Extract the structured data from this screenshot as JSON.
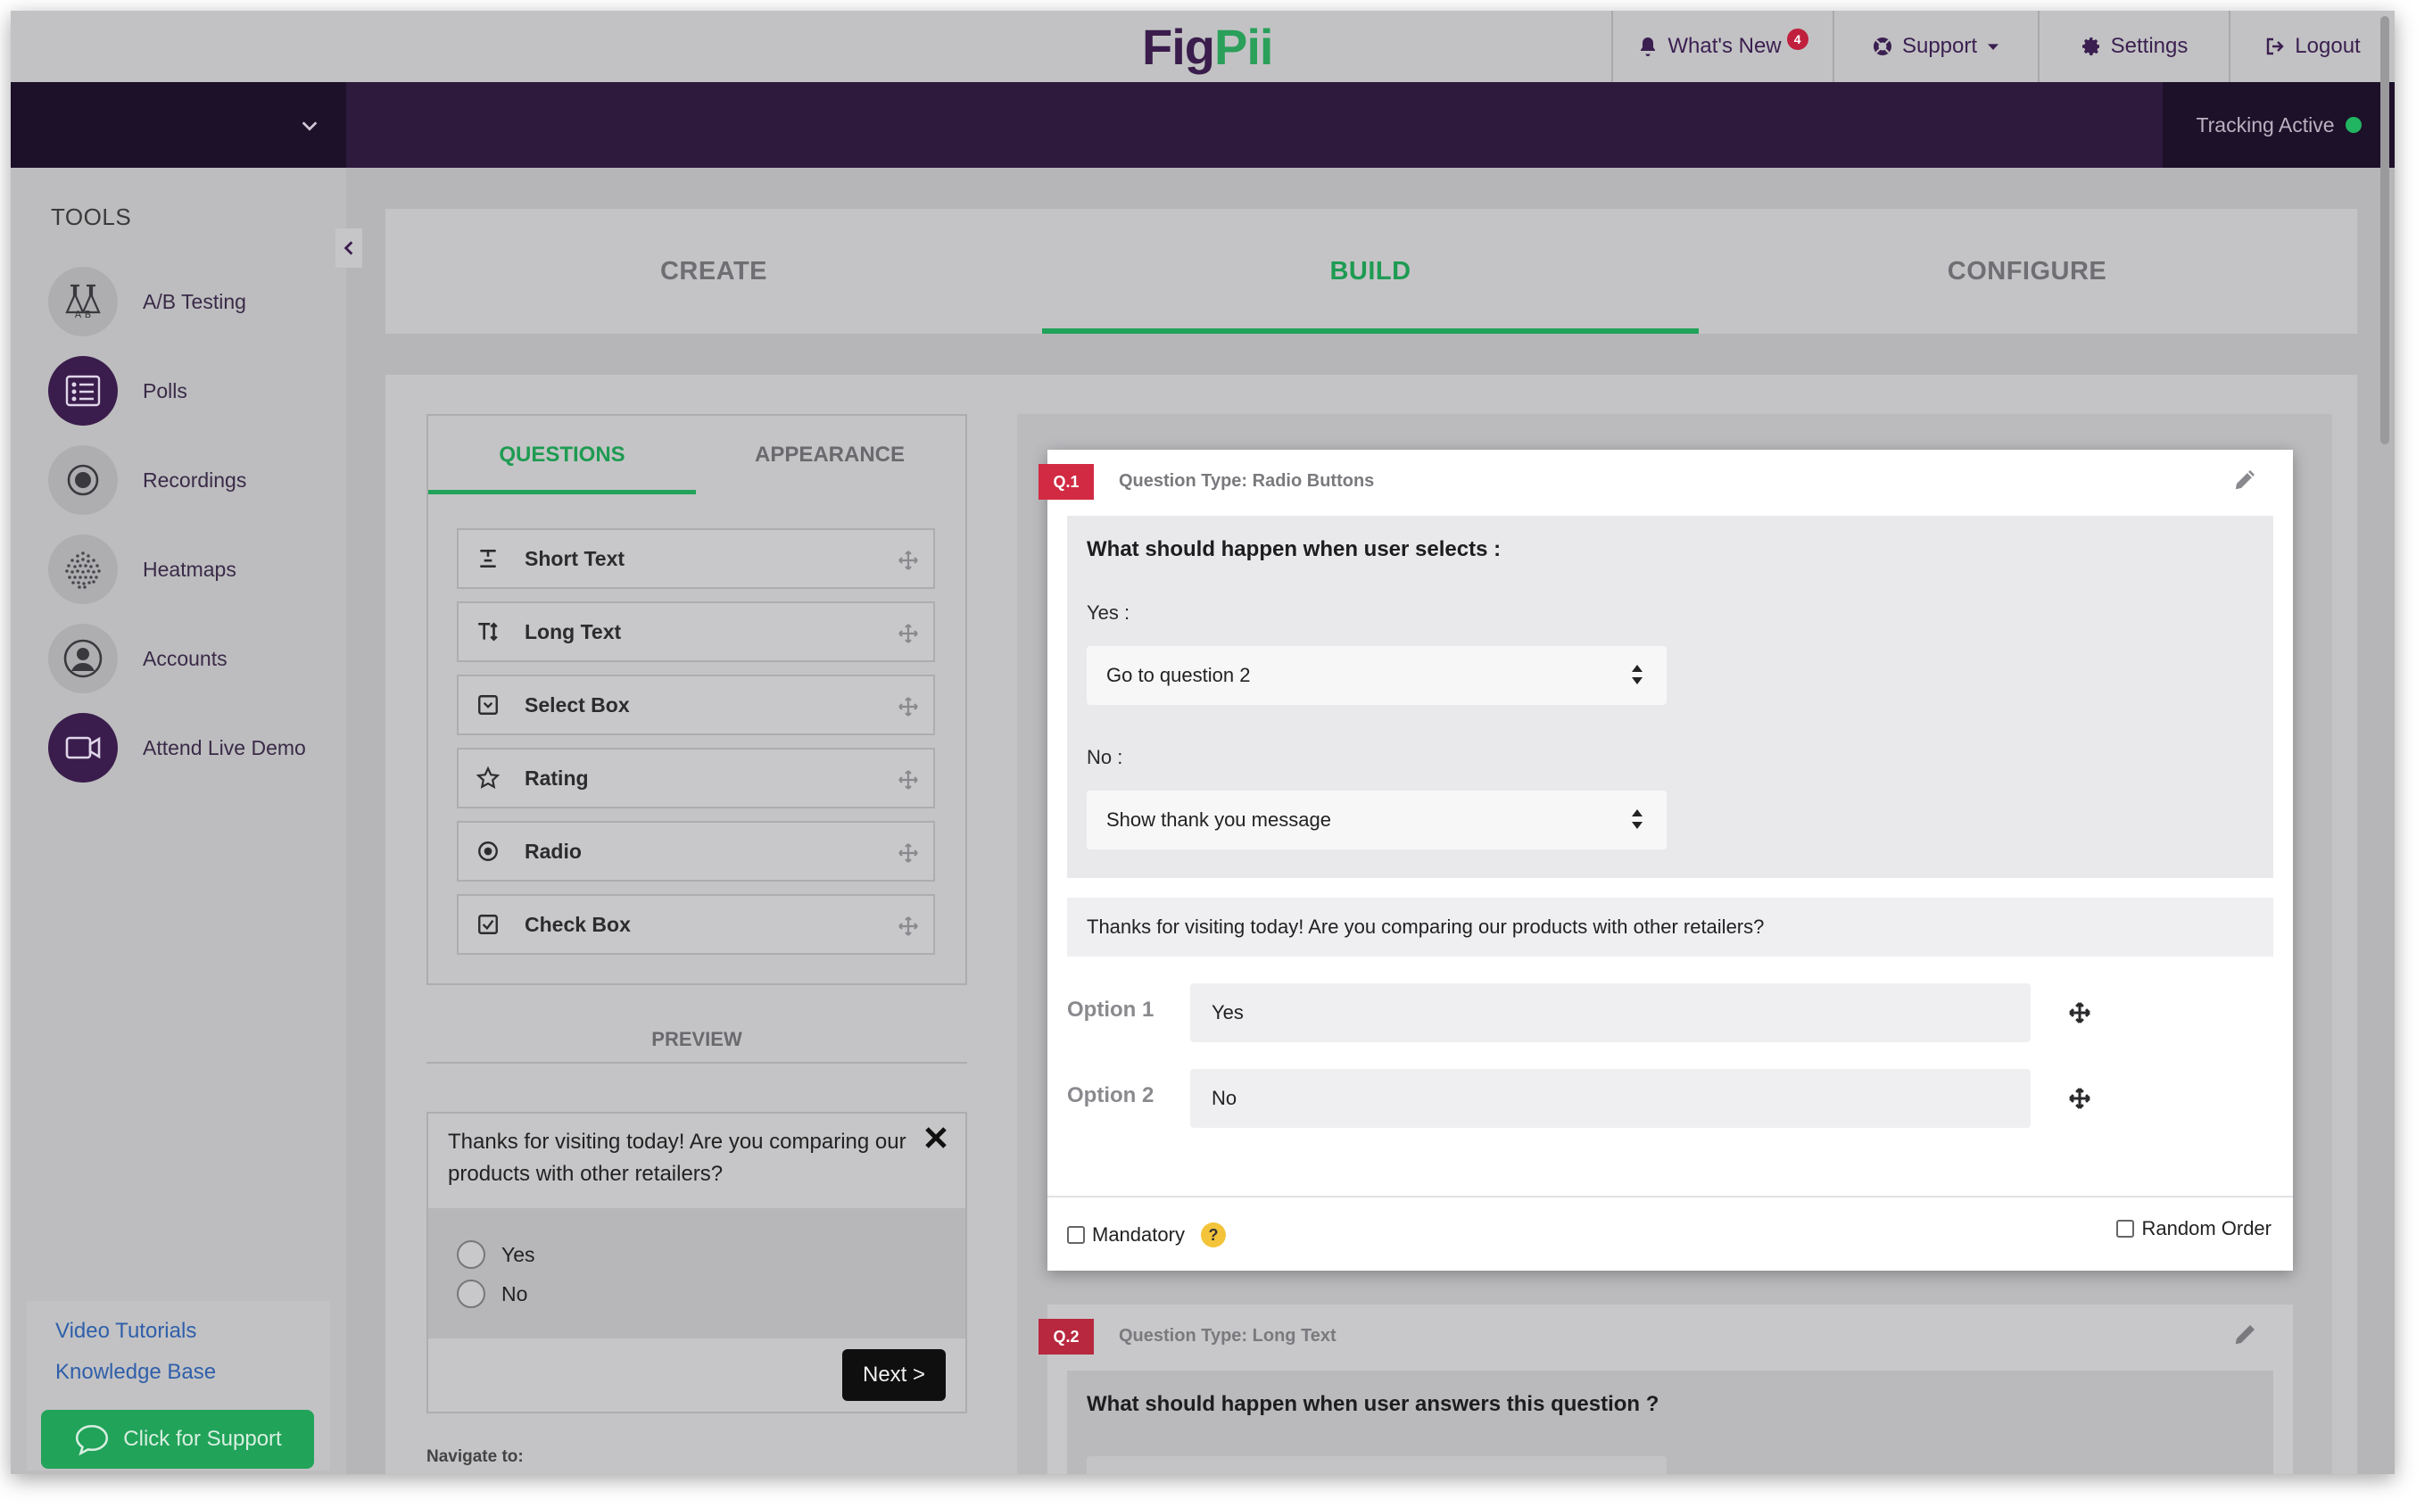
{
  "app": {
    "logo_part1": "Fig",
    "logo_part2": "Pii"
  },
  "topnav": {
    "whats_new": "What's New",
    "whats_new_badge": "4",
    "support": "Support",
    "settings": "Settings",
    "logout": "Logout"
  },
  "tracking": {
    "label": "Tracking Active"
  },
  "sidebar": {
    "title": "TOOLS",
    "items": [
      {
        "label": "A/B Testing",
        "icon": "flask-icon"
      },
      {
        "label": "Polls",
        "icon": "poll-list-icon",
        "active": true
      },
      {
        "label": "Recordings",
        "icon": "record-icon"
      },
      {
        "label": "Heatmaps",
        "icon": "heatmap-dots-icon"
      },
      {
        "label": "Accounts",
        "icon": "user-circle-icon"
      },
      {
        "label": "Attend Live Demo",
        "icon": "video-camera-icon"
      }
    ],
    "video_tutorials": "Video Tutorials",
    "knowledge_base": "Knowledge Base",
    "support_button": "Click for Support"
  },
  "steps": {
    "create": "CREATE",
    "build": "BUILD",
    "configure": "CONFIGURE",
    "active": "BUILD"
  },
  "question_panel": {
    "tab_questions": "QUESTIONS",
    "tab_appearance": "APPEARANCE",
    "types": [
      "Short Text",
      "Long Text",
      "Select Box",
      "Rating",
      "Radio",
      "Check Box"
    ]
  },
  "preview": {
    "heading": "PREVIEW",
    "question": "Thanks for visiting today! Are you comparing our products with other retailers?",
    "options": [
      "Yes",
      "No"
    ],
    "next_button": "Next >",
    "navigate_label": "Navigate to:"
  },
  "q1": {
    "num": "Q.1",
    "type_label": "Question Type: Radio Buttons",
    "logic_title": "What should happen when user selects :",
    "yes_label": "Yes :",
    "yes_action": "Go to question 2",
    "no_label": "No :",
    "no_action": "Show thank you message",
    "question_text": "Thanks for visiting today! Are you comparing our products with other retailers?",
    "option1_label": "Option 1",
    "option1_value": "Yes",
    "option2_label": "Option 2",
    "option2_value": "No",
    "mandatory": "Mandatory",
    "help": "?",
    "random_order": "Random Order"
  },
  "q2": {
    "num": "Q.2",
    "type_label": "Question Type: Long Text",
    "logic_title": "What should happen when user answers this question ?"
  },
  "colors": {
    "brand_purple": "#3a1d4c",
    "accent_green": "#21a35a",
    "question_red": "#d22a43"
  }
}
